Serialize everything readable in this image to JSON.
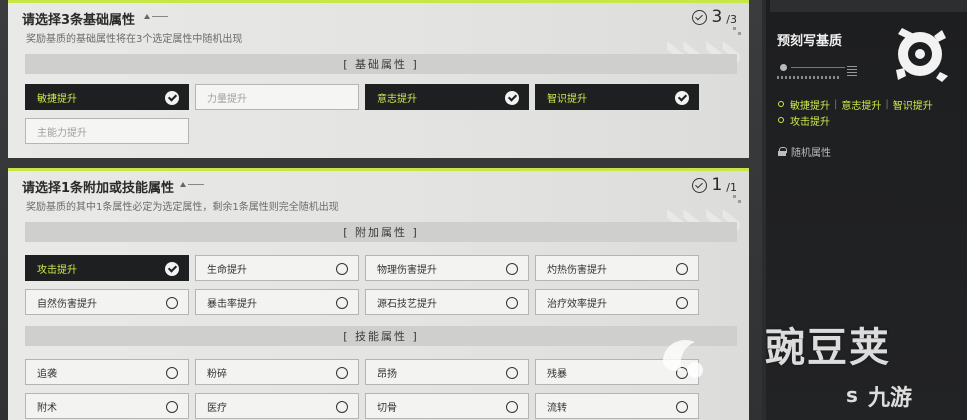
{
  "panel1": {
    "title": "请选择3条基础属性",
    "subtitle": "奖励基质的基础属性将在3个选定属性中随机出现",
    "counter_value": "3",
    "counter_total": "/3",
    "section": "[ 基础属性 ]",
    "options": [
      {
        "label": "敏捷提升",
        "state": "selected"
      },
      {
        "label": "力量提升",
        "state": "disabled"
      },
      {
        "label": "意志提升",
        "state": "selected"
      },
      {
        "label": "智识提升",
        "state": "selected"
      },
      {
        "label": "主能力提升",
        "state": "disabled"
      }
    ]
  },
  "panel2": {
    "title": "请选择1条附加或技能属性",
    "subtitle": "奖励基质的其中1条属性必定为选定属性，剩余1条属性则完全随机出现",
    "counter_value": "1",
    "counter_total": "/1",
    "section_extra": "[ 附加属性 ]",
    "extra_options": [
      {
        "label": "攻击提升",
        "state": "selected"
      },
      {
        "label": "生命提升",
        "state": "unselected"
      },
      {
        "label": "物理伤害提升",
        "state": "unselected"
      },
      {
        "label": "灼热伤害提升",
        "state": "unselected"
      },
      {
        "label": "自然伤害提升",
        "state": "unselected"
      },
      {
        "label": "暴击率提升",
        "state": "unselected"
      },
      {
        "label": "源石技艺提升",
        "state": "unselected"
      },
      {
        "label": "治疗效率提升",
        "state": "unselected"
      }
    ],
    "section_skill": "[ 技能属性 ]",
    "skill_options": [
      {
        "label": "追袭",
        "state": "unselected"
      },
      {
        "label": "粉碎",
        "state": "unselected"
      },
      {
        "label": "昂扬",
        "state": "unselected"
      },
      {
        "label": "残暴",
        "state": "unselected"
      },
      {
        "label": "附术",
        "state": "unselected"
      },
      {
        "label": "医疗",
        "state": "unselected"
      },
      {
        "label": "切骨",
        "state": "unselected"
      },
      {
        "label": "流转",
        "state": "unselected"
      }
    ]
  },
  "preview": {
    "title": "预刻写基质",
    "stats_row1": [
      "敏捷提升",
      "意志提升",
      "智识提升"
    ],
    "stats_row2": "攻击提升",
    "random_label": "随机属性"
  },
  "watermarks": {
    "wandoujia": "豌豆荚",
    "jiuyou": "九游",
    "jiuyou_prefix": "s"
  },
  "colors": {
    "accent": "#cfe94a",
    "selected_bg": "#1e1f20",
    "panel_bg": "#e6e6e4"
  }
}
